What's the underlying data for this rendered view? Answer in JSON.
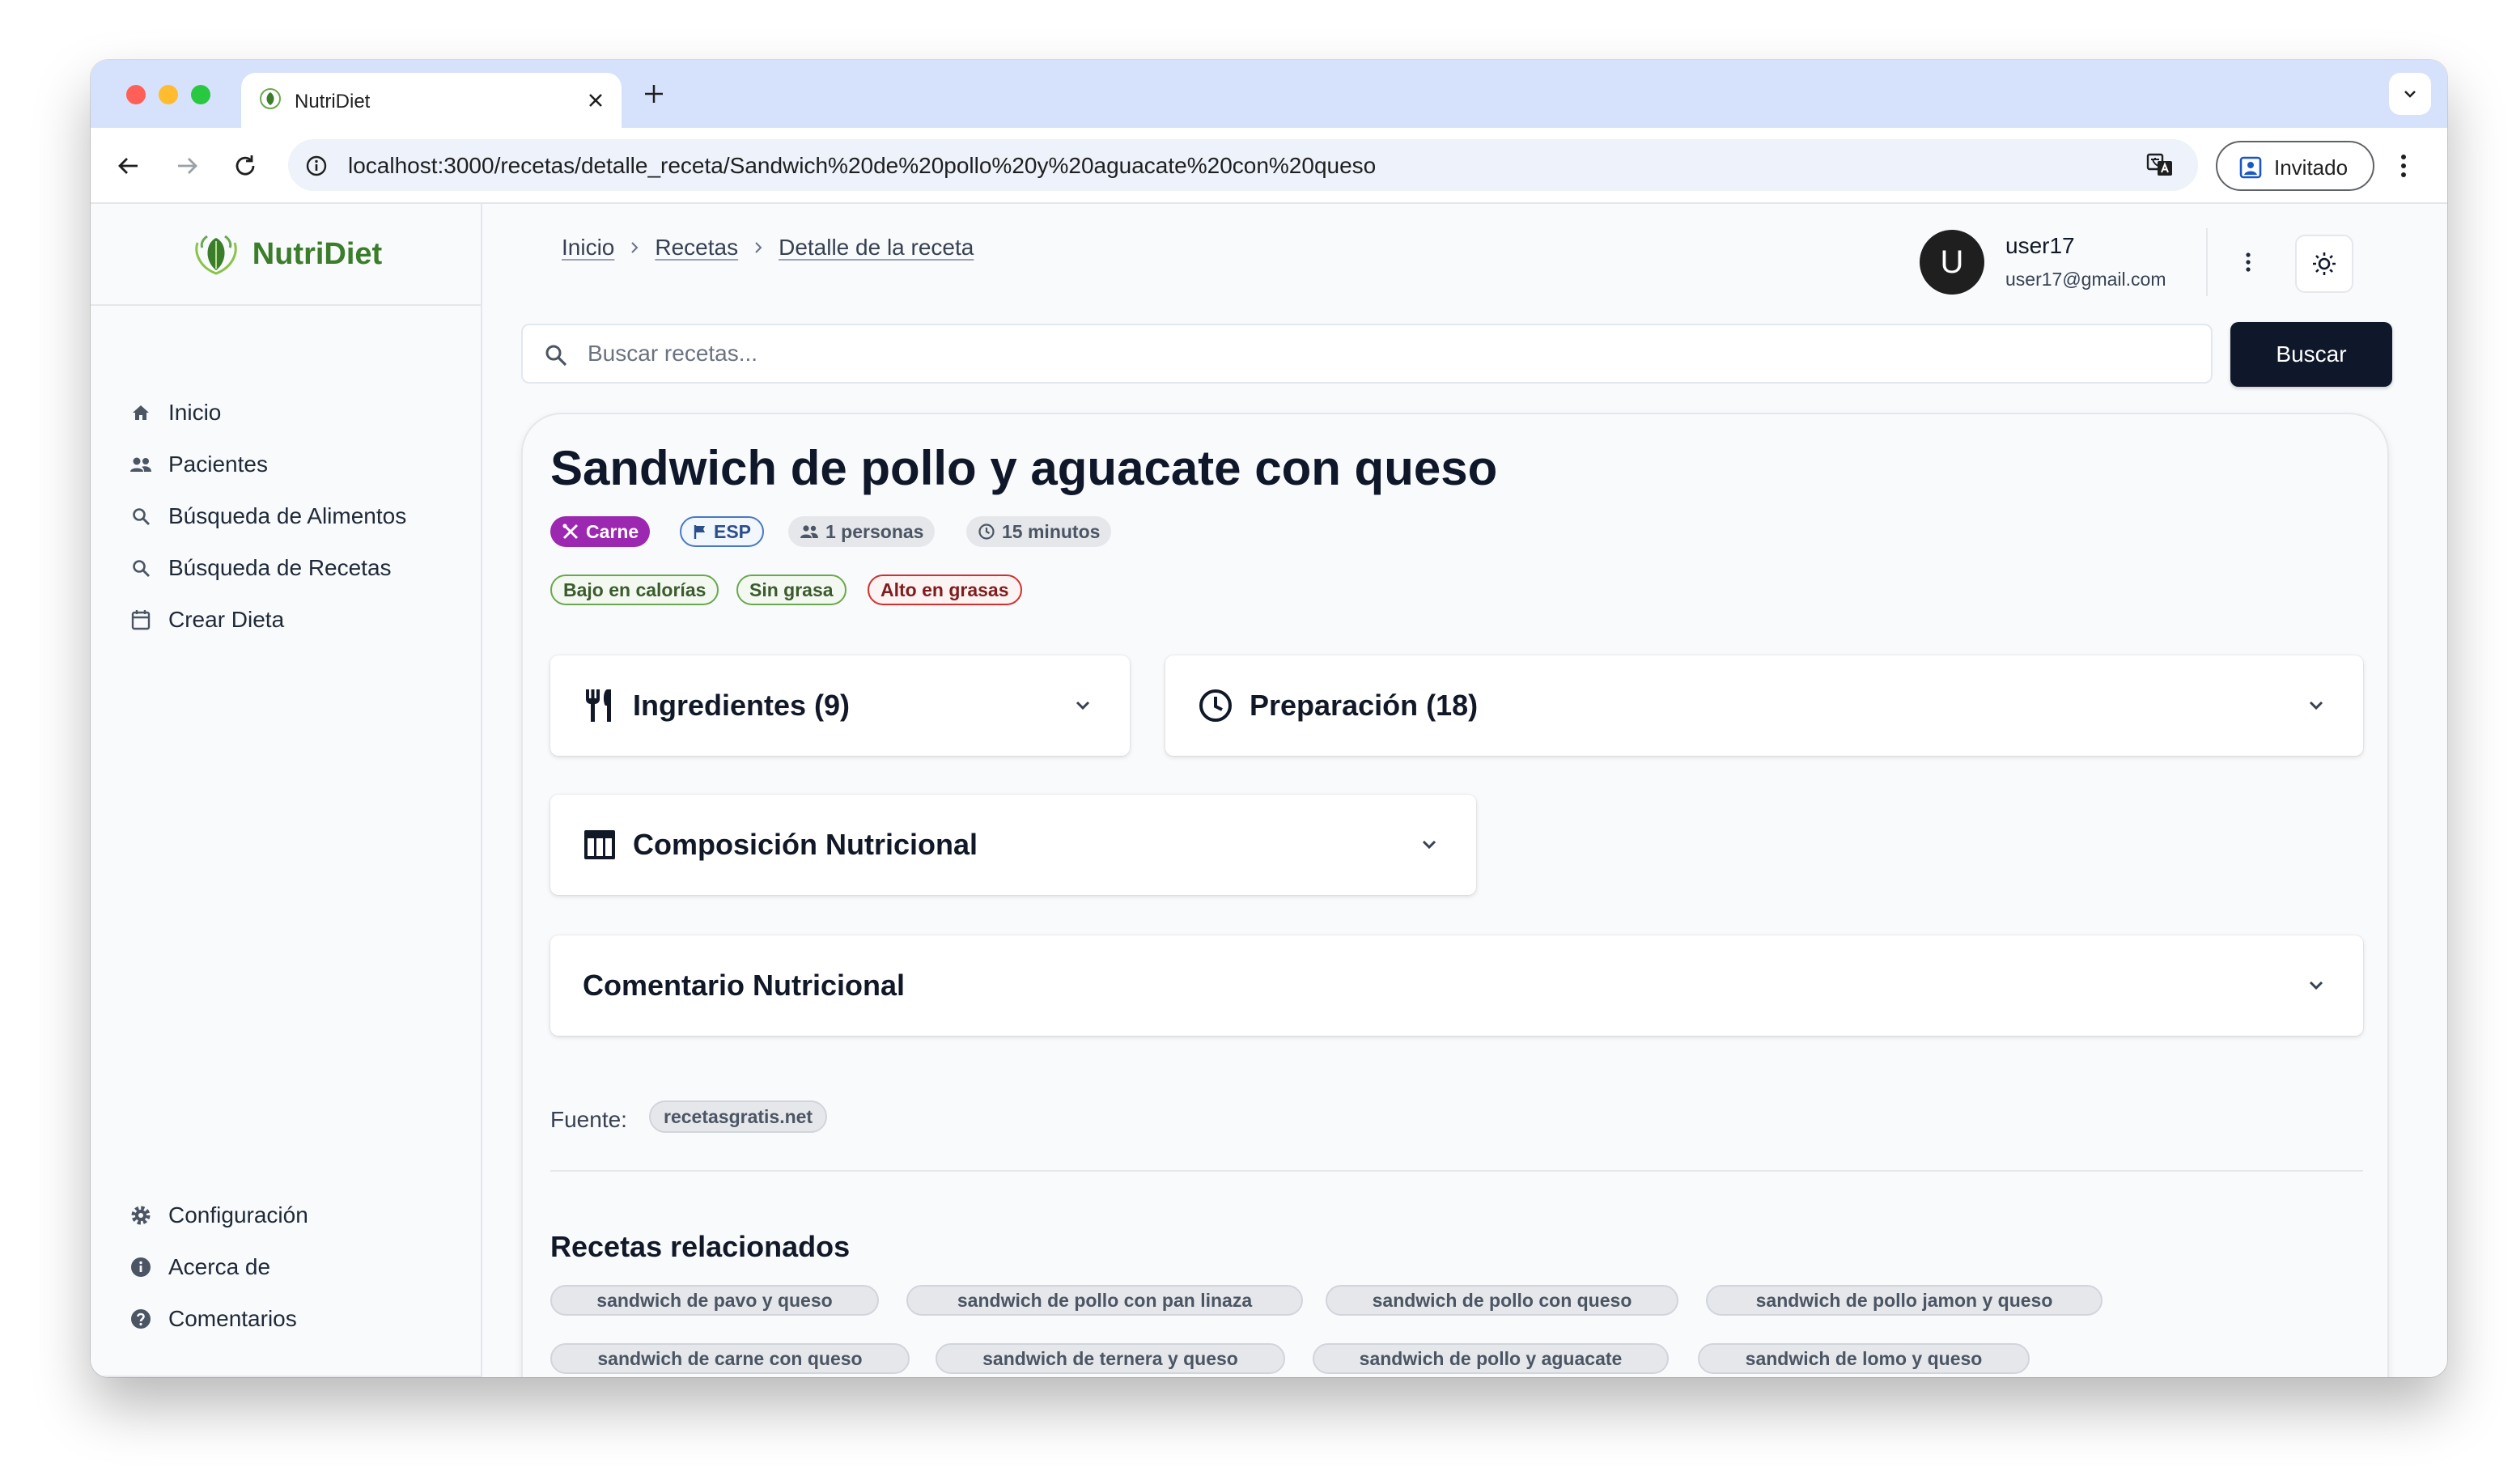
{
  "browser": {
    "tab_title": "NutriDiet",
    "url": "localhost:3000/recetas/detalle_receta/Sandwich%20de%20pollo%20y%20aguacate%20con%20queso",
    "profile_label": "Invitado"
  },
  "app": {
    "logo_text": "NutriDiet",
    "brand_color": "#3b7d2a"
  },
  "sidebar": {
    "items": [
      {
        "label": "Inicio",
        "icon": "home-icon"
      },
      {
        "label": "Pacientes",
        "icon": "people-icon"
      },
      {
        "label": "Búsqueda de Alimentos",
        "icon": "search-icon"
      },
      {
        "label": "Búsqueda de Recetas",
        "icon": "search-icon"
      },
      {
        "label": "Crear Dieta",
        "icon": "calendar-icon"
      }
    ],
    "bottom_items": [
      {
        "label": "Configuración",
        "icon": "gear-icon"
      },
      {
        "label": "Acerca de",
        "icon": "info-icon"
      },
      {
        "label": "Comentarios",
        "icon": "help-icon"
      }
    ]
  },
  "breadcrumb": [
    "Inicio",
    "Recetas",
    "Detalle de la receta"
  ],
  "user": {
    "avatar_letter": "U",
    "name": "user17",
    "email": "user17@gmail.com"
  },
  "search": {
    "placeholder": "Buscar recetas...",
    "button_label": "Buscar"
  },
  "recipe": {
    "title": "Sandwich de pollo y aguacate con queso",
    "category": "Carne",
    "language": "ESP",
    "servings": "1 personas",
    "time": "15 minutos",
    "tags": [
      {
        "label": "Bajo en calorías",
        "color": "#6aa84f"
      },
      {
        "label": "Sin grasa",
        "color": "#6aa84f"
      },
      {
        "label": "Alto en grasas",
        "color": "#d32f2f"
      }
    ],
    "sections": {
      "ingredients": "Ingredientes (9)",
      "preparation": "Preparación (18)",
      "composition": "Composición Nutricional",
      "comment": "Comentario Nutricional"
    },
    "source_label": "Fuente:",
    "source": "recetasgratis.net"
  },
  "related": {
    "title": "Recetas relacionados",
    "items": [
      "sandwich de pavo y queso",
      "sandwich de pollo con pan linaza",
      "sandwich de pollo con queso",
      "sandwich de pollo jamon y queso",
      "sandwich de carne con queso",
      "sandwich de ternera y queso",
      "sandwich de pollo y aguacate",
      "sandwich de lomo y queso"
    ]
  }
}
